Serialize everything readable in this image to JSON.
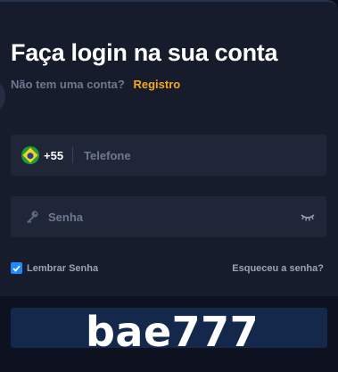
{
  "login": {
    "title": "Faça login na sua conta",
    "no_account_text": "Não tem uma conta?",
    "register_link": "Registro",
    "phone": {
      "country_code": "+55",
      "placeholder": "Telefone",
      "flag_icon": "brazil-flag-icon"
    },
    "password": {
      "placeholder": "Senha",
      "key_icon": "key-icon",
      "visibility_icon": "eye-closed-icon"
    },
    "remember_label": "Lembrar Senha",
    "remember_checked": true,
    "forgot_link": "Esqueceu a senha?"
  },
  "watermark": "bae777",
  "colors": {
    "accent_link": "#f5a623",
    "checkbox": "#1e88ff",
    "panel": "#161c2b",
    "field": "#1f2637"
  }
}
